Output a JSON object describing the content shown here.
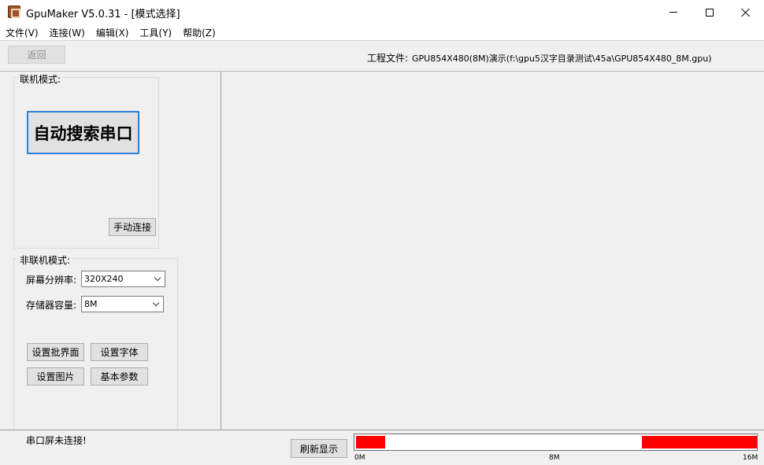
{
  "window": {
    "title": "GpuMaker V5.0.31 - [模式选择]",
    "icons": {
      "app": "gpumaker-app-icon",
      "minimize": "minimize-icon",
      "maximize": "maximize-icon",
      "close": "close-icon"
    }
  },
  "menu": [
    "文件(V)",
    "连接(W)",
    "编辑(X)",
    "工具(Y)",
    "帮助(Z)"
  ],
  "toolbar": {
    "back_label": "返回",
    "project_label": "工程文件:",
    "project_path": "GPU854X480(8M)演示(f:\\gpu5汉字目录测试\\45a\\GPU854X480_8M.gpu)"
  },
  "online": {
    "group_label": "联机模式:",
    "auto_search_label": "自动搜索串口",
    "manual_connect_label": "手动连接"
  },
  "offline": {
    "group_label": "非联机模式:",
    "resolution_label": "屏幕分辨率:",
    "resolution_value": "320X240",
    "memory_label": "存储器容量:",
    "memory_value": "8M",
    "buttons": {
      "set_interface": "设置批界面",
      "set_font": "设置字体",
      "set_image": "设置图片",
      "basic_params": "基本参数"
    }
  },
  "status": {
    "text": "串口屏未连接!",
    "refresh_label": "刷新显示",
    "memory_bar": {
      "color": "#ff0000",
      "ticks": [
        "0M",
        "8M",
        "16M"
      ],
      "used_ranges_mb": [
        [
          0,
          1.15
        ],
        [
          11.4,
          16
        ]
      ]
    }
  }
}
